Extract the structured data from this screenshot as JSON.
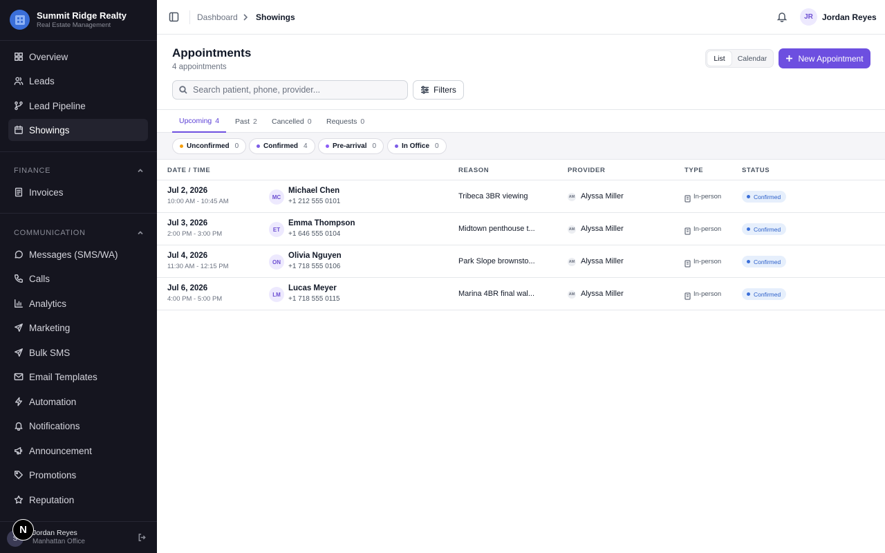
{
  "brand": {
    "name": "Summit Ridge Realty",
    "subtitle": "Real Estate Management"
  },
  "sidebar": {
    "main_items": [
      {
        "label": "Overview",
        "icon": "grid-icon"
      },
      {
        "label": "Leads",
        "icon": "users-icon"
      },
      {
        "label": "Lead Pipeline",
        "icon": "pipeline-icon"
      },
      {
        "label": "Showings",
        "icon": "calendar-icon",
        "active": true
      }
    ],
    "finance": {
      "title": "FINANCE",
      "items": [
        {
          "label": "Invoices",
          "icon": "invoice-icon"
        }
      ]
    },
    "communication": {
      "title": "COMMUNICATION",
      "items": [
        {
          "label": "Messages (SMS/WA)",
          "icon": "message-icon"
        },
        {
          "label": "Calls",
          "icon": "phone-icon"
        },
        {
          "label": "Analytics",
          "icon": "chart-icon"
        },
        {
          "label": "Marketing",
          "icon": "send-icon"
        },
        {
          "label": "Bulk SMS",
          "icon": "send-icon"
        },
        {
          "label": "Email Templates",
          "icon": "mail-icon"
        },
        {
          "label": "Automation",
          "icon": "zap-icon"
        },
        {
          "label": "Notifications",
          "icon": "bell-icon"
        },
        {
          "label": "Announcement",
          "icon": "megaphone-icon"
        },
        {
          "label": "Promotions",
          "icon": "tag-icon"
        },
        {
          "label": "Reputation",
          "icon": "star-icon"
        }
      ]
    },
    "footer": {
      "avatar": "S",
      "badge": "N",
      "name": "Jordan Reyes",
      "office": "Manhattan Office"
    }
  },
  "topbar": {
    "breadcrumb": [
      "Dashboard",
      "Showings"
    ],
    "user": {
      "initials": "JR",
      "name": "Jordan Reyes"
    }
  },
  "page": {
    "title": "Appointments",
    "subtitle": "4 appointments",
    "view_toggle": {
      "list": "List",
      "calendar": "Calendar",
      "selected": "List"
    },
    "new_button": "New Appointment",
    "search_placeholder": "Search patient, phone, provider...",
    "filters_label": "Filters"
  },
  "tabs": [
    {
      "label": "Upcoming",
      "count": "4",
      "active": true
    },
    {
      "label": "Past",
      "count": "2"
    },
    {
      "label": "Cancelled",
      "count": "0"
    },
    {
      "label": "Requests",
      "count": "0"
    }
  ],
  "status_chips": [
    {
      "label": "Unconfirmed",
      "count": "0",
      "color": "#f59e0b"
    },
    {
      "label": "Confirmed",
      "count": "4",
      "color": "#7c5ce6"
    },
    {
      "label": "Pre-arrival",
      "count": "0",
      "color": "#8b5cf6"
    },
    {
      "label": "In Office",
      "count": "0",
      "color": "#7c5ce6"
    }
  ],
  "table": {
    "columns": [
      "DATE / TIME",
      "REASON",
      "PROVIDER",
      "TYPE",
      "STATUS"
    ],
    "rows": [
      {
        "date": "Jul 2, 2026",
        "time": "10:00 AM - 10:45 AM",
        "initials": "MC",
        "name": "Michael Chen",
        "phone": "+1 212 555 0101",
        "reason": "Tribeca 3BR viewing",
        "provider_initials": "AM",
        "provider": "Alyssa Miller",
        "type": "In-person",
        "status": "Confirmed"
      },
      {
        "date": "Jul 3, 2026",
        "time": "2:00 PM - 3:00 PM",
        "initials": "ET",
        "name": "Emma Thompson",
        "phone": "+1 646 555 0104",
        "reason": "Midtown penthouse t...",
        "provider_initials": "AM",
        "provider": "Alyssa Miller",
        "type": "In-person",
        "status": "Confirmed"
      },
      {
        "date": "Jul 4, 2026",
        "time": "11:30 AM - 12:15 PM",
        "initials": "ON",
        "name": "Olivia Nguyen",
        "phone": "+1 718 555 0106",
        "reason": "Park Slope brownsto...",
        "provider_initials": "AM",
        "provider": "Alyssa Miller",
        "type": "In-person",
        "status": "Confirmed"
      },
      {
        "date": "Jul 6, 2026",
        "time": "4:00 PM - 5:00 PM",
        "initials": "LM",
        "name": "Lucas Meyer",
        "phone": "+1 718 555 0115",
        "reason": "Marina 4BR final wal...",
        "provider_initials": "AM",
        "provider": "Alyssa Miller",
        "type": "In-person",
        "status": "Confirmed"
      }
    ]
  }
}
